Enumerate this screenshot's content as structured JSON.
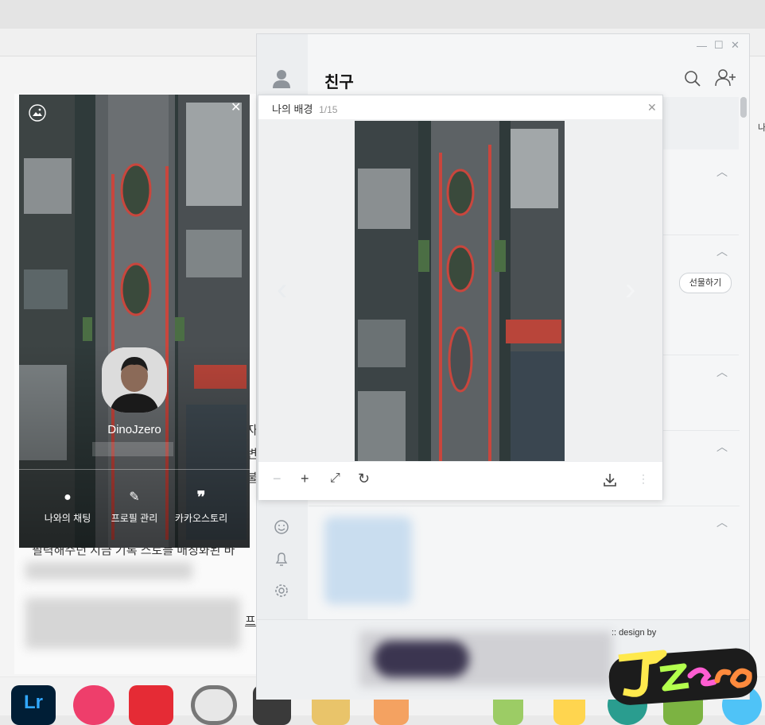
{
  "friends_window": {
    "title": "친구",
    "gift_button": "선물하기",
    "design_by": ":: design by",
    "logo_text": "Jzero"
  },
  "profile_card": {
    "name": "DinoJzero",
    "actions": [
      {
        "label": "나와의 채팅",
        "icon": "chat-bubble-icon"
      },
      {
        "label": "프로필 관리",
        "icon": "pencil-icon"
      },
      {
        "label": "카카오스토리",
        "icon": "quote-icon"
      }
    ]
  },
  "image_viewer": {
    "title": "나의 배경",
    "counter": "1/15"
  },
  "background_page": {
    "fragment_1": "자",
    "fragment_2": "변",
    "fragment_3": "불",
    "fragment_4": "필력해주던 지금 기록 스토를 매칭화된 바",
    "fragment_5": "프",
    "edge_label": "나"
  },
  "colors": {
    "window_bg": "#f5f6f7",
    "sidebar_bg": "#eceef0",
    "viewer_bg": "#ffffff"
  }
}
